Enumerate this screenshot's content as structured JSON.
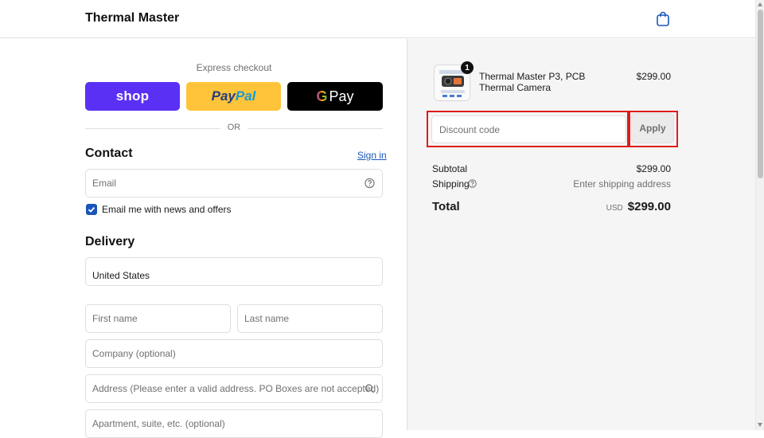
{
  "header": {
    "brand": "Thermal Master",
    "cart_icon": "shopping-bag-icon"
  },
  "express": {
    "label": "Express checkout",
    "shop_label": "shop",
    "paypal_part1": "Pay",
    "paypal_part2": "Pal",
    "gpay_g": "G",
    "gpay_label": "Pay",
    "or_text": "OR"
  },
  "contact": {
    "heading": "Contact",
    "signin_label": "Sign in",
    "email_placeholder": "Email",
    "newsletter_label": "Email me with news and offers",
    "newsletter_checked": true
  },
  "delivery": {
    "heading": "Delivery",
    "country_value": "United States",
    "first_name_placeholder": "First name",
    "last_name_placeholder": "Last name",
    "company_placeholder": "Company (optional)",
    "address_placeholder": "Address (Please enter a valid address. PO Boxes are not accepted)",
    "apartment_placeholder": "Apartment, suite, etc. (optional)"
  },
  "order": {
    "item": {
      "name": "Thermal Master P3, PCB Thermal Camera",
      "price": "$299.00",
      "quantity": "1"
    },
    "discount_placeholder": "Discount code",
    "apply_label": "Apply",
    "subtotal_label": "Subtotal",
    "subtotal_value": "$299.00",
    "shipping_label": "Shipping",
    "shipping_value": "Enter shipping address",
    "total_label": "Total",
    "currency": "USD",
    "total_value": "$299.00"
  },
  "colors": {
    "shop_pay": "#5a31f4",
    "paypal": "#ffc439",
    "link": "#1a56b8",
    "highlight": "#e01b1b"
  }
}
